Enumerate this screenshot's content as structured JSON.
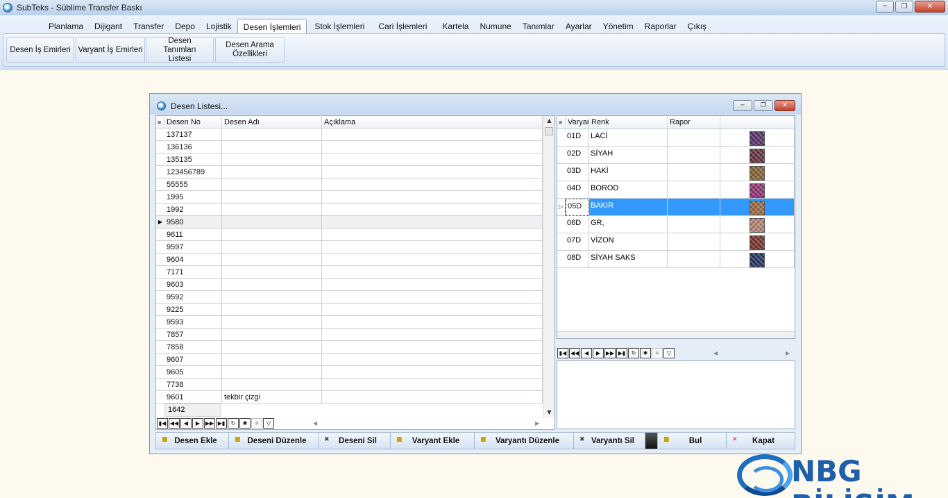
{
  "window": {
    "title": "SubTeks - Süblime Transfer Baskı"
  },
  "menu": {
    "tabs": [
      "Planlama",
      "Dijigant",
      "Transfer",
      "Depo",
      "Lojistik",
      "Desen İşlemleri",
      "Stok İşlemleri",
      "Cari İşlemleri",
      "Kartela",
      "Numune",
      "Tanımlar",
      "Ayarlar",
      "Yönetim",
      "Raporlar",
      "Çıkış"
    ],
    "active": "Desen İşlemleri"
  },
  "ribbon": {
    "buttons": [
      "Desen İş Emirleri",
      "Varyant İş Emirleri",
      "Desen Tanımları Listesi",
      "Desen Arama Özellikleri"
    ]
  },
  "child_window": {
    "title": "Desen Listesi..."
  },
  "left_grid": {
    "columns": [
      "Desen No",
      "Desen Adı",
      "Açıklama"
    ],
    "rows": [
      [
        "137137",
        "",
        ""
      ],
      [
        "136136",
        "",
        ""
      ],
      [
        "135135",
        "",
        ""
      ],
      [
        "123456789",
        "",
        ""
      ],
      [
        "55555",
        "",
        ""
      ],
      [
        "1995",
        "",
        ""
      ],
      [
        "1992",
        "",
        ""
      ],
      [
        "9580",
        "",
        ""
      ],
      [
        "9611",
        "",
        ""
      ],
      [
        "9597",
        "",
        ""
      ],
      [
        "9604",
        "",
        ""
      ],
      [
        "7171",
        "",
        ""
      ],
      [
        "9603",
        "",
        ""
      ],
      [
        "9592",
        "",
        ""
      ],
      [
        "9225",
        "",
        ""
      ],
      [
        "9593",
        "",
        ""
      ],
      [
        "7857",
        "",
        ""
      ],
      [
        "7858",
        "",
        ""
      ],
      [
        "9607",
        "",
        ""
      ],
      [
        "9605",
        "",
        ""
      ],
      [
        "7738",
        "",
        ""
      ],
      [
        "9601",
        "tekbir çizgi",
        ""
      ]
    ],
    "current_row_index": 7,
    "record_count": "1642"
  },
  "right_grid": {
    "columns": [
      "Varyar",
      "Renk",
      "Rapor",
      ""
    ],
    "rows": [
      {
        "varyant": "01D",
        "renk": "LACİ",
        "rapor": "",
        "color": "#5b3a6e"
      },
      {
        "varyant": "02D",
        "renk": "SİYAH",
        "rapor": "",
        "color": "#6b3a4a"
      },
      {
        "varyant": "03D",
        "renk": "HAKİ",
        "rapor": "",
        "color": "#8a6a3a"
      },
      {
        "varyant": "04D",
        "renk": "BOROD",
        "rapor": "",
        "color": "#9a3a78"
      },
      {
        "varyant": "05D",
        "renk": "BAKIR",
        "rapor": "",
        "color": "#a0704a"
      },
      {
        "varyant": "06D",
        "renk": "GR,",
        "rapor": "",
        "color": "#b88a7a"
      },
      {
        "varyant": "07D",
        "renk": "VİZON",
        "rapor": "",
        "color": "#7a3a32"
      },
      {
        "varyant": "08D",
        "renk": "SİYAH SAKS",
        "rapor": "",
        "color": "#2c3a6a"
      }
    ],
    "selected_row_index": 4
  },
  "actions": {
    "desen_ekle": "Desen Ekle",
    "deseni_duzenle": "Deseni Düzenle",
    "deseni_sil": "Deseni Sil",
    "varyant_ekle": "Varyant Ekle",
    "varyanti_duzenle": "Varyantı Düzenle",
    "varyanti_sil": "Varyantı Sil",
    "bul": "Bul",
    "kapat": "Kapat"
  },
  "logo": {
    "text": "NBG BİLİŞİM"
  },
  "colors": {
    "selection": "#3399ff",
    "logo_blue": "#1f5faa"
  }
}
